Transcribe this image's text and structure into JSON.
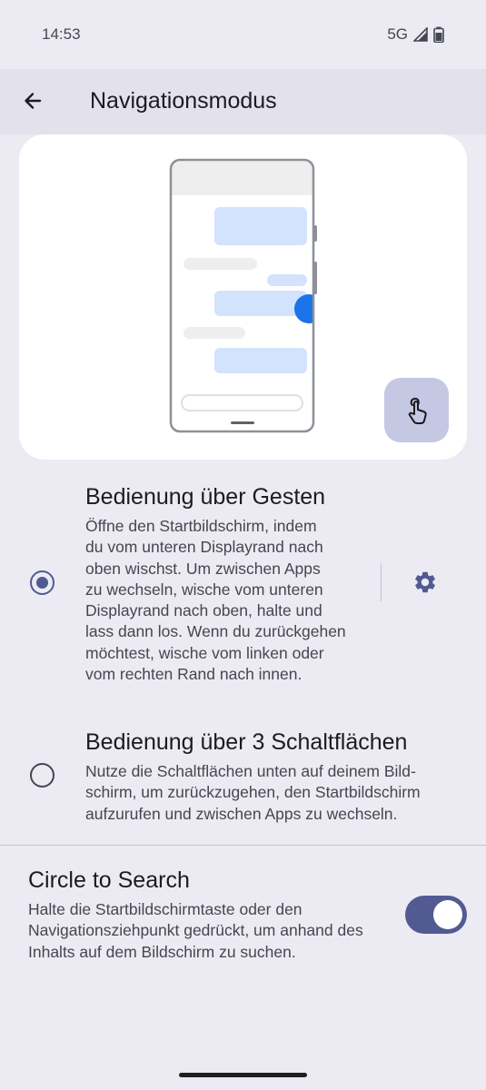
{
  "status_bar": {
    "time": "14:53",
    "network": "5G"
  },
  "app_bar": {
    "title": "Navigationsmodus",
    "back_icon": "arrow-back-icon"
  },
  "options": [
    {
      "title": "Bedienung über Gesten",
      "description_lines": [
        "Öffne den Startbildschirm, indem",
        "du vom unteren Displayrand nach",
        "oben wischst. Um zwischen Apps",
        "zu wechseln, wische vom unteren",
        "Displayrand nach oben, halte und",
        "lass dann los. Wenn du zurückgehen",
        "möchtest, wische vom linken oder",
        "vom rechten Rand nach innen."
      ],
      "selected": true,
      "settings_icon": "gear-icon"
    },
    {
      "title": "Bedienung über 3 Schaltflächen",
      "description_lines": [
        "Nutze die Schaltflächen unten auf deinem Bild-",
        "schirm, um zurückzugehen, den Startbildschirm",
        "aufzurufen und zwischen Apps zu wechseln."
      ],
      "selected": false
    }
  ],
  "circle_to_search": {
    "title": "Circle to Search",
    "description_lines": [
      "Halte die Startbildschirmtaste oder den",
      "Navigationsziehpunkt gedrückt, um anhand des",
      "Inhalts auf dem Bildschirm zu suchen."
    ],
    "enabled": true
  },
  "colors": {
    "background": "#ECEBF3",
    "accent": "#515A91",
    "bubble": "#D3E3FD",
    "swipe_dot": "#1A73E8"
  }
}
